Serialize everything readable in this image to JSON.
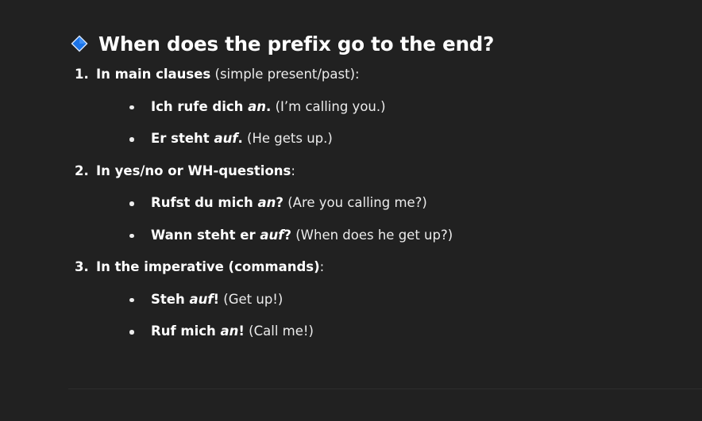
{
  "heading": {
    "icon": "blue-diamond-icon",
    "text": "When does the prefix go to the end?"
  },
  "colors": {
    "background": "#212121",
    "diamond_fill": "#1a73e8",
    "diamond_edge": "#d9e8ff",
    "text": "#ececec"
  },
  "steps": [
    {
      "number": "1.",
      "title": "In main clauses",
      "rest": " (simple present/past):",
      "examples": [
        {
          "before": "Ich rufe dich ",
          "prefix": "an",
          "after_bold": ".",
          "translation": " (I’m calling you.)"
        },
        {
          "before": "Er steht ",
          "prefix": "auf",
          "after_bold": ".",
          "translation": " (He gets up.)"
        }
      ]
    },
    {
      "number": "2.",
      "title": "In yes/no or WH-questions",
      "rest": ":",
      "examples": [
        {
          "before": "Rufst du mich ",
          "prefix": "an",
          "after_bold": "?",
          "translation": " (Are you calling me?)"
        },
        {
          "before": "Wann steht er ",
          "prefix": "auf",
          "after_bold": "?",
          "translation": " (When does he get up?)"
        }
      ]
    },
    {
      "number": "3.",
      "title": "In the imperative (commands)",
      "rest": ":",
      "examples": [
        {
          "before": "Steh ",
          "prefix": "auf",
          "after_bold": "!",
          "translation": " (Get up!)"
        },
        {
          "before": "Ruf mich ",
          "prefix": "an",
          "after_bold": "!",
          "translation": " (Call me!)"
        }
      ]
    }
  ]
}
